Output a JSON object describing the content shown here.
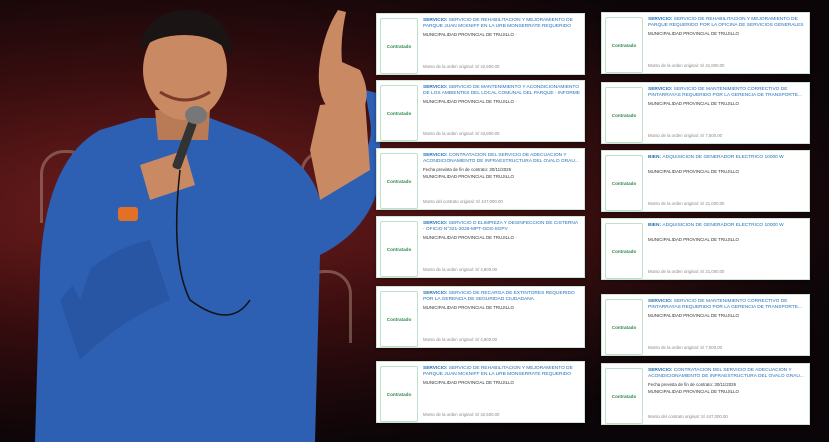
{
  "cards_left": [
    {
      "status": "Contratado",
      "type": "SERVICIO:",
      "title": "SERVICIO DE REHABILITACION Y MEJORAMIENTO DE PARQUE JUAN MCKNIFF EN LA URB MONSERRATE REQUERIDO POR...",
      "lines": [
        "MUNICIPALIDAD PROVINCIAL DE TRUJILLO"
      ],
      "amount_label": "Monto de la orden original:",
      "amount": "S/ 42,500.00"
    },
    {
      "status": "Contratado",
      "type": "SERVICIO:",
      "title": "SERVICIO DE MANTENIMIENTO Y ACONDICIONAMIENTO DE LOS AMBIENTES DEL LOCAL COMUNAL DEL PARQUE - INFORME N°200...",
      "lines": [
        "MUNICIPALIDAD PROVINCIAL DE TRUJILLO"
      ],
      "amount_label": "Monto de la orden original:",
      "amount": "S/ 43,800.00"
    },
    {
      "status": "Contratado",
      "type": "SERVICIO:",
      "title": "CONTRATACION DEL SERVICIO DE ADECUACION Y ACONDICIONAMIENTO DE INFRAESTRUCTURA DEL OVALO GRAU...",
      "lines": [
        "Fecha prevista de fin de contrato: 30/11/2026",
        "MUNICIPALIDAD PROVINCIAL DE TRUJILLO"
      ],
      "amount_label": "Monto del contrato original:",
      "amount": "S/ 447,000.00"
    },
    {
      "status": "Contratado",
      "type": "SERVICIO:",
      "title": "SERVICIO D ELIMPIEZA Y DESINFECCION DE CISTERNA - OFICIO N°321-2026-MPT-GDS-SGPV",
      "lines": [
        "MUNICIPALIDAD PROVINCIAL DE TRUJILLO"
      ],
      "amount_label": "Monto de la orden original:",
      "amount": "S/ 4,800.00"
    },
    {
      "status": "Contratado",
      "type": "SERVICIO:",
      "title": "SERVICIO DE RECARGA DE EXTINTORES REQUERIDO POR LA GERENCIA DE SEGURIDAD CIUDADANA",
      "lines": [
        "MUNICIPALIDAD PROVINCIAL DE TRUJILLO"
      ],
      "amount_label": "Monto de la orden original:",
      "amount": "S/ 4,900.00"
    },
    {
      "status": "Contratado",
      "type": "SERVICIO:",
      "title": "SERVICIO DE REHABILITACION Y MEJORAMIENTO DE PARQUE JUAN MCKNIFF EN LA URB MONSERRATE REQUERIDO POR...",
      "lines": [
        "MUNICIPALIDAD PROVINCIAL DE TRUJILLO"
      ],
      "amount_label": "Monto de la orden original:",
      "amount": "S/ 42,500.00"
    }
  ],
  "cards_right": [
    {
      "status": "Contratado",
      "type": "SERVICIO:",
      "title": "SERVICIO DE REHABILITACION Y MEJORAMIENTO DE PARQUE REQUERIDO POR LA OFICINA DE SERVICIOS GENERALES",
      "lines": [
        "MUNICIPALIDAD PROVINCIAL DE TRUJILLO"
      ],
      "amount_label": "Monto de la orden original:",
      "amount": "S/ 41,800.00"
    },
    {
      "status": "Contratado",
      "type": "SERVICIO:",
      "title": "SERVICIO DE MANTENIMIENTO CORRECTIVO DE PINTARRAYAS REQUERIDO POR LA GERENCIA DE TRANSPORTE...",
      "lines": [
        "MUNICIPALIDAD PROVINCIAL DE TRUJILLO"
      ],
      "amount_label": "Monto de la orden original:",
      "amount": "S/ 7,500.00"
    },
    {
      "status": "Contratado",
      "type": "BIEN:",
      "title": "ADQUISICION DE GENERADOR ELECTRICO 10000 W",
      "lines": [
        "MUNICIPALIDAD PROVINCIAL DE TRUJILLO"
      ],
      "amount_label": "Monto de la orden original:",
      "amount": "S/ 21,000.00"
    },
    {
      "status": "Contratado",
      "type": "BIEN:",
      "title": "ADQUISICION DE GENERADOR ELECTRICO 10000 W",
      "lines": [
        "MUNICIPALIDAD PROVINCIAL DE TRUJILLO"
      ],
      "amount_label": "Monto de la orden original:",
      "amount": "S/ 21,000.00"
    },
    {
      "status": "Contratado",
      "type": "SERVICIO:",
      "title": "SERVICIO DE MANTENIMIENTO CORRECTIVO DE PINTARRAYAS REQUERIDO POR LA GERENCIA DE TRANSPORTE...",
      "lines": [
        "MUNICIPALIDAD PROVINCIAL DE TRUJILLO"
      ],
      "amount_label": "Monto de la orden original:",
      "amount": "S/ 7,000.00"
    },
    {
      "status": "Contratado",
      "type": "SERVICIO:",
      "title": "CONTRATACION DEL SERVICIO DE ADECUACION Y ACONDICIONAMIENTO DE INFRAESTRUCTURA DEL OVALO GRAU...",
      "lines": [
        "Fecha prevista de fin de contrato: 30/11/2026",
        "MUNICIPALIDAD PROVINCIAL DE TRUJILLO"
      ],
      "amount_label": "Monto del contrato original:",
      "amount": "S/ 447,000.00"
    }
  ]
}
